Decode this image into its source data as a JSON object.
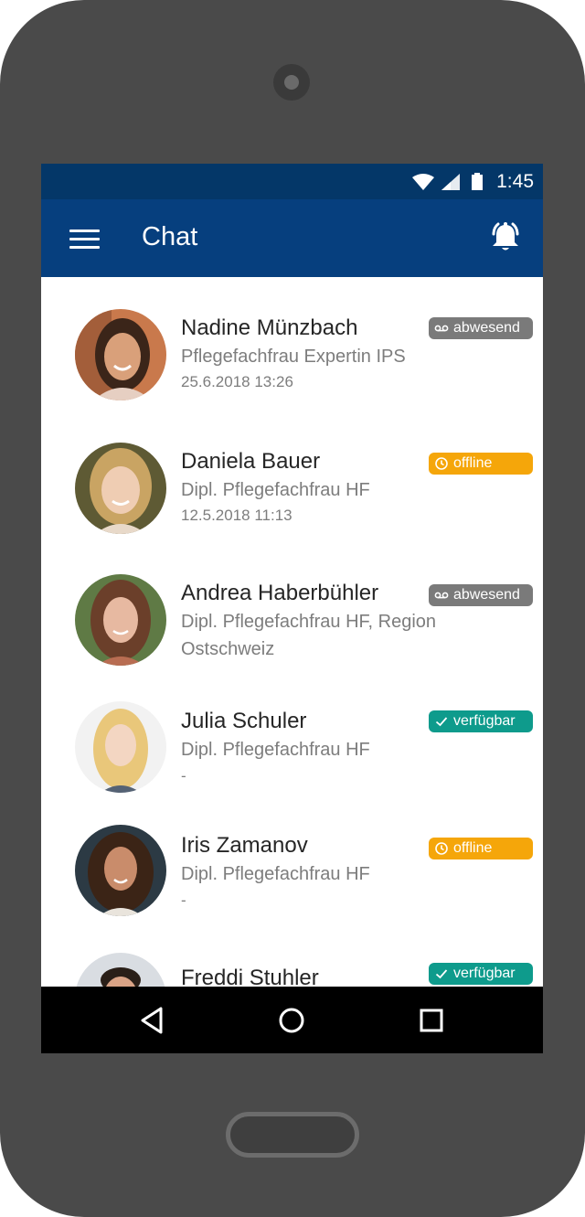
{
  "status_bar": {
    "time": "1:45"
  },
  "app_bar": {
    "title": "Chat",
    "menu_icon": "menu-icon",
    "bell_icon": "bell-ringing-icon"
  },
  "colors": {
    "status_bar": "#043768",
    "app_bar": "#063f7e",
    "abwesend": "#7a7a7a",
    "offline": "#f5a60a",
    "verfuegbar": "#0e9b8c"
  },
  "contacts": [
    {
      "name": "Nadine Münzbach",
      "role": "Pflegefachfrau Expertin IPS",
      "date": "25.6.2018 13:26",
      "status": "abwesend",
      "status_icon": "voicemail-icon"
    },
    {
      "name": "Daniela Bauer",
      "role": "Dipl. Pflegefachfrau HF",
      "date": "12.5.2018 11:13",
      "status": "offline",
      "status_icon": "clock-icon"
    },
    {
      "name": "Andrea Haberbühler",
      "role": "Dipl. Pflegefachfrau HF, Region Ostschweiz",
      "date": "",
      "status": "abwesend",
      "status_icon": "voicemail-icon"
    },
    {
      "name": "Julia Schuler",
      "role": "Dipl. Pflegefachfrau HF",
      "date": "-",
      "status": "verfügbar",
      "status_icon": "check-icon"
    },
    {
      "name": "Iris Zamanov",
      "role": "Dipl. Pflegefachfrau HF",
      "date": "-",
      "status": "offline",
      "status_icon": "clock-icon"
    },
    {
      "name": "Freddi Stuhler",
      "role": "",
      "date": "",
      "status": "verfügbar",
      "status_icon": "check-icon"
    }
  ],
  "nav_bar": {
    "back_icon": "back-triangle-icon",
    "home_icon": "home-circle-icon",
    "recents_icon": "recents-square-icon"
  }
}
